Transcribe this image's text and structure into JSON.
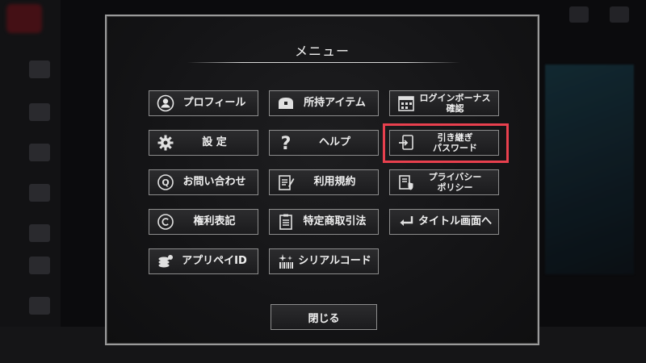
{
  "modal": {
    "title": "メニュー",
    "close_label": "閉じる"
  },
  "menu": [
    {
      "label": "プロフィール",
      "icon": "user-circle-icon"
    },
    {
      "label": "所持アイテム",
      "icon": "treasure-chest-icon"
    },
    {
      "label": "ログインボーナス確認",
      "label_lines": [
        "ログインボーナス",
        "確認"
      ],
      "icon": "calendar-check-icon"
    },
    {
      "label": "設 定",
      "icon": "gear-icon"
    },
    {
      "label": "ヘルプ",
      "icon": "question-icon"
    },
    {
      "label": "引き継ぎパスワード",
      "label_lines": [
        "引き継ぎ",
        "パスワード"
      ],
      "icon": "device-transfer-icon",
      "highlighted": true
    },
    {
      "label": "お問い合わせ",
      "icon": "speech-question-icon"
    },
    {
      "label": "利用規約",
      "icon": "document-pen-icon"
    },
    {
      "label": "プライバシーポリシー",
      "label_lines": [
        "プライバシー",
        "ポリシー"
      ],
      "icon": "shield-document-icon"
    },
    {
      "label": "権利表記",
      "icon": "copyright-icon"
    },
    {
      "label": "特定商取引法",
      "icon": "clipboard-list-icon"
    },
    {
      "label": "タイトル画面へ",
      "icon": "return-arrow-icon"
    },
    {
      "label": "アプリペイID",
      "icon": "coins-icon"
    },
    {
      "label": "シリアルコード",
      "icon": "barcode-sparkle-icon"
    }
  ],
  "colors": {
    "highlight": "#e8404e",
    "button_border": "#8d8d8d",
    "text": "#f0f0f0"
  }
}
